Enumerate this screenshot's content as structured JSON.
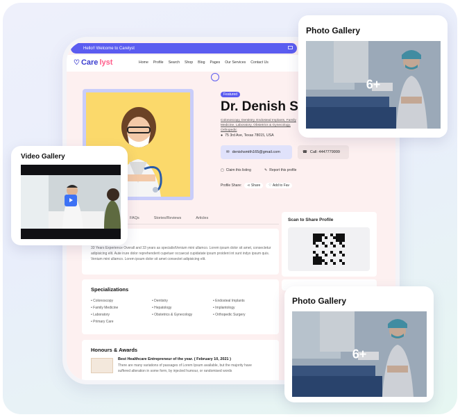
{
  "topbar": {
    "welcome": "Hello!! Welcome to Carelyst"
  },
  "brand": {
    "name_prefix": "Care",
    "name_suffix": "lyst"
  },
  "nav": {
    "items": [
      "Home",
      "Profile",
      "Search",
      "Shop",
      "Blog",
      "Pages",
      "Our Services",
      "Contact Us"
    ]
  },
  "profile": {
    "badge": "Featured",
    "name": "Dr. Denish Sm",
    "specialties": "Colonoscopy, Dentistry, Endosteal Implants, Family Medicine, Laboratory, Obstetrics & Gynecology, Orthopedic",
    "address": "75 3rd Ave, Texas 78015, USA",
    "email": "denishsmith165@gmail.com",
    "call": "Call: 4447779999",
    "claim": "Claim this listing",
    "report": "Report this profile",
    "share_label": "Profile Share:",
    "share": "Share",
    "add_fav": "Add to Fav"
  },
  "tabs": [
    "FAQs",
    "Stories/Reviews",
    "Articles"
  ],
  "about": {
    "text": "33 Years Experience Overall and 33 years as specialistVenium mini ullamco. Lorem ipsum dolor sit amet, consectetur adipisicing elit. Aute irure dolor reprehenderit cupetuer occaecat cupidatate ipsum proident int sunt indyx ipsum quis. Venium mini ullamco. Lorem ipsum dolor sit amet consectet adipisicing elit."
  },
  "qr": {
    "title": "Scan to Share Profile"
  },
  "specializations": {
    "title": "Specializations",
    "items": [
      "Colonoscopy",
      "Dentistry",
      "Endosteal Implants",
      "Family Medicine",
      "Hepatology",
      "Implantology",
      "Laboratory",
      "Obstetrics & Gynecology",
      "Orthopedic Surgery",
      "Primary Care"
    ]
  },
  "honours": {
    "title": "Honours & Awards",
    "award_title": "Best Healthcare Entrepreneur of the year. ( February 10, 2021 )",
    "award_text": "There are many variations of passages of Lorem Ipsum available, but the majority have suffered alteration in some form, by injected humour, or randomised words"
  },
  "photo_gallery": {
    "title": "Photo Gallery",
    "count": "6+"
  },
  "video_gallery": {
    "title": "Video Gallery"
  },
  "colors": {
    "primary": "#5b5cf0",
    "accent": "#ff5c8a",
    "page_bg": "#fdf0f0",
    "play": "#3d72f5"
  },
  "icons": [
    "mail-icon",
    "heart-logo-icon",
    "location-pin-icon",
    "envelope-icon",
    "phone-icon",
    "claim-icon",
    "report-icon",
    "share-icon",
    "fav-icon",
    "play-icon"
  ]
}
